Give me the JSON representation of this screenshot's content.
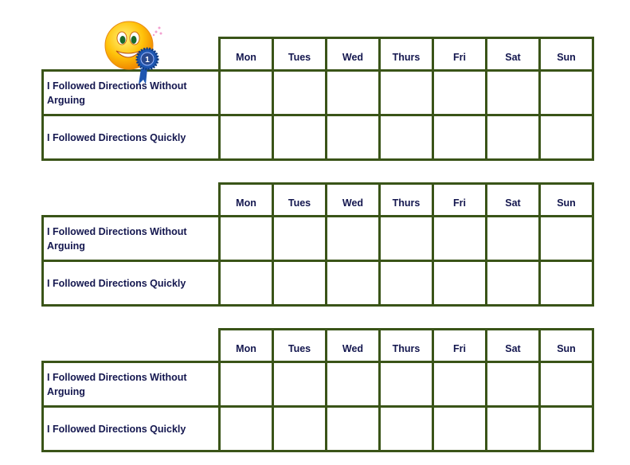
{
  "days": [
    "Mon",
    "Tues",
    "Wed",
    "Thurs",
    "Fri",
    "Sat",
    "Sun"
  ],
  "rows": [
    "I  Followed Directions Without Arguing",
    "I Followed Directions Quickly"
  ],
  "charts": 3,
  "colors": {
    "border": "#3a5418",
    "text": "#14174f"
  },
  "decoration": {
    "icon": "smiley-with-first-place-ribbon-icon",
    "ribbon_text": "1"
  }
}
